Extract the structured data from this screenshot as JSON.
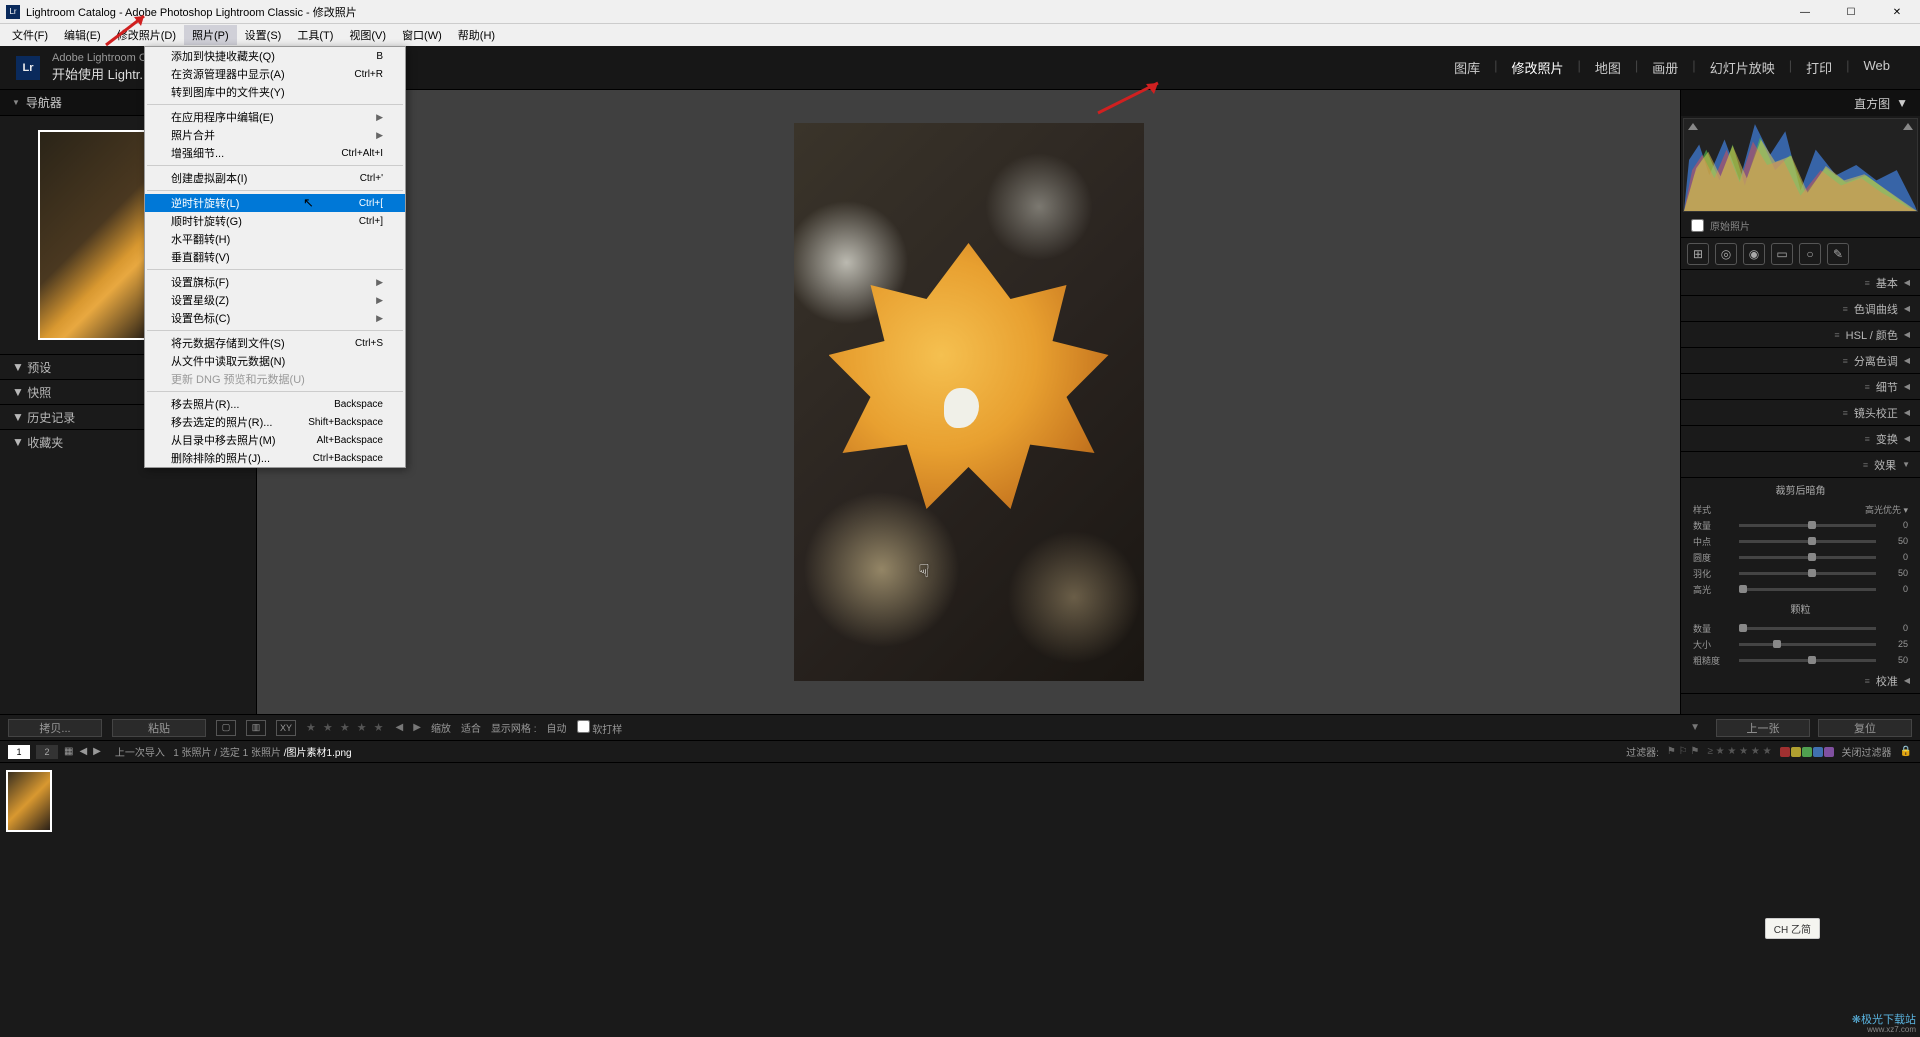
{
  "title": "Lightroom Catalog - Adobe Photoshop Lightroom Classic - 修改照片",
  "brand_small": "Adobe Lightroom Classic",
  "brand_action": "开始使用 Lightr...",
  "menubar": [
    "文件(F)",
    "编辑(E)",
    "修改照片(D)",
    "照片(P)",
    "设置(S)",
    "工具(T)",
    "视图(V)",
    "窗口(W)",
    "帮助(H)"
  ],
  "modules": [
    "图库",
    "修改照片",
    "地图",
    "画册",
    "幻灯片放映",
    "打印",
    "Web"
  ],
  "left_header": "导航器",
  "left_sections": [
    "预设",
    "快照",
    "历史记录",
    "收藏夹"
  ],
  "dropdown": {
    "items": [
      {
        "label": "添加到快捷收藏夹(Q)",
        "shortcut": "B"
      },
      {
        "label": "在资源管理器中显示(A)",
        "shortcut": "Ctrl+R"
      },
      {
        "label": "转到图库中的文件夹(Y)",
        "shortcut": ""
      },
      {
        "sep": true
      },
      {
        "label": "在应用程序中编辑(E)",
        "shortcut": "",
        "sub": true
      },
      {
        "label": "照片合并",
        "shortcut": "",
        "sub": true
      },
      {
        "label": "增强细节...",
        "shortcut": "Ctrl+Alt+I"
      },
      {
        "sep": true
      },
      {
        "label": "创建虚拟副本(I)",
        "shortcut": "Ctrl+'"
      },
      {
        "sep": true
      },
      {
        "label": "逆时针旋转(L)",
        "shortcut": "Ctrl+[",
        "hl": true
      },
      {
        "label": "顺时针旋转(G)",
        "shortcut": "Ctrl+]"
      },
      {
        "label": "水平翻转(H)",
        "shortcut": ""
      },
      {
        "label": "垂直翻转(V)",
        "shortcut": ""
      },
      {
        "sep": true
      },
      {
        "label": "设置旗标(F)",
        "shortcut": "",
        "sub": true
      },
      {
        "label": "设置星级(Z)",
        "shortcut": "",
        "sub": true
      },
      {
        "label": "设置色标(C)",
        "shortcut": "",
        "sub": true
      },
      {
        "sep": true
      },
      {
        "label": "将元数据存储到文件(S)",
        "shortcut": "Ctrl+S"
      },
      {
        "label": "从文件中读取元数据(N)",
        "shortcut": ""
      },
      {
        "label": "更新 DNG 预览和元数据(U)",
        "shortcut": "",
        "disabled": true
      },
      {
        "sep": true
      },
      {
        "label": "移去照片(R)...",
        "shortcut": "Backspace"
      },
      {
        "label": "移去选定的照片(R)...",
        "shortcut": "Shift+Backspace"
      },
      {
        "label": "从目录中移去照片(M)",
        "shortcut": "Alt+Backspace"
      },
      {
        "label": "删除排除的照片(J)...",
        "shortcut": "Ctrl+Backspace"
      }
    ]
  },
  "right_header": "直方图",
  "orig_label": "原始照片",
  "sections": [
    "基本",
    "色调曲线",
    "HSL / 颜色",
    "分离色调",
    "细节",
    "镜头校正",
    "变换",
    "效果",
    "校准"
  ],
  "vignette_title": "裁剪后暗角",
  "sliders1": [
    {
      "label": "样式",
      "text": "高光优先"
    },
    {
      "label": "数量",
      "val": "0",
      "pos": 50
    },
    {
      "label": "中点",
      "val": "50",
      "pos": 50
    },
    {
      "label": "圆度",
      "val": "0",
      "pos": 50
    },
    {
      "label": "羽化",
      "val": "50",
      "pos": 50
    },
    {
      "label": "高光",
      "val": "0",
      "pos": 0
    }
  ],
  "grain_title": "颗粒",
  "sliders2": [
    {
      "label": "数量",
      "val": "0",
      "pos": 0
    },
    {
      "label": "大小",
      "val": "25",
      "pos": 25
    },
    {
      "label": "粗糙度",
      "val": "50",
      "pos": 50
    }
  ],
  "toolbar": {
    "copy": "拷贝...",
    "paste": "粘贴",
    "zoom": "缩放",
    "fit": "适合",
    "grid": "显示网格 :",
    "auto": "自动",
    "soft": "软打样",
    "prev": "上一张",
    "reset": "复位"
  },
  "filter": {
    "lastImport": "上一次导入",
    "count": "1 张照片 / 选定 1 张照片",
    "filename": "/图片素材1.png",
    "filterLabel": "过滤器:",
    "closeFilter": "关闭过滤器"
  },
  "ime": "CH 乙简",
  "watermark1": "❋极光下载站",
  "watermark2": "www.xz7.com"
}
